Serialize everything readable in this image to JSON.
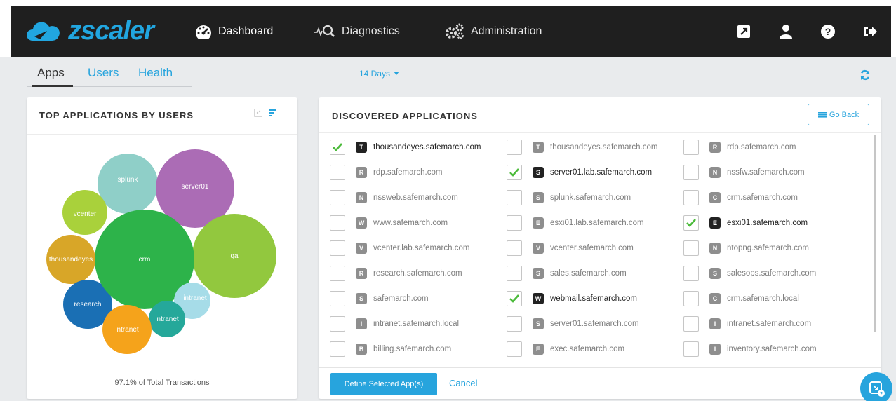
{
  "brand": {
    "name": "zscaler",
    "accent": "#27a4dd"
  },
  "nav": {
    "dashboard": "Dashboard",
    "diagnostics": "Diagnostics",
    "administration": "Administration"
  },
  "top_icons": [
    "external-link-icon",
    "user-icon",
    "help-icon",
    "logout-icon"
  ],
  "tabs": {
    "apps": "Apps",
    "users": "Users",
    "health": "Health"
  },
  "range": {
    "label": "14 Days"
  },
  "left_panel": {
    "title": "TOP APPLICATIONS BY USERS",
    "footnote": "97.1% of Total Transactions",
    "bubbles": [
      {
        "label": "splunk",
        "color": "#8fcfc8"
      },
      {
        "label": "server01",
        "color": "#ab6cb5"
      },
      {
        "label": "vcenter",
        "color": "#a9d13b"
      },
      {
        "label": "crm",
        "color": "#2db34a"
      },
      {
        "label": "qa",
        "color": "#92c83e"
      },
      {
        "label": "thousandeyes",
        "color": "#d8a628"
      },
      {
        "label": "research",
        "color": "#1a6fb4"
      },
      {
        "label": "intranet",
        "color": "#f5a31b"
      },
      {
        "label": "intranet",
        "color": "#25a89a"
      },
      {
        "label": "intranet",
        "color": "#a6dce8"
      }
    ]
  },
  "right_panel": {
    "title": "DISCOVERED APPLICATIONS",
    "go_back": "Go Back",
    "define_button": "Define Selected App(s)",
    "cancel": "Cancel",
    "columns": [
      [
        {
          "letter": "T",
          "name": "thousandeyes.safemarch.com",
          "checked": true
        },
        {
          "letter": "R",
          "name": "rdp.safemarch.com",
          "checked": false
        },
        {
          "letter": "N",
          "name": "nssweb.safemarch.com",
          "checked": false
        },
        {
          "letter": "W",
          "name": "www.safemarch.com",
          "checked": false
        },
        {
          "letter": "V",
          "name": "vcenter.lab.safemarch.com",
          "checked": false
        },
        {
          "letter": "R",
          "name": "research.safemarch.com",
          "checked": false
        },
        {
          "letter": "S",
          "name": "safemarch.com",
          "checked": false
        },
        {
          "letter": "I",
          "name": "intranet.safemarch.local",
          "checked": false
        },
        {
          "letter": "B",
          "name": "billing.safemarch.com",
          "checked": false
        }
      ],
      [
        {
          "letter": "T",
          "name": "thousandeyes.safemarch.com",
          "checked": false
        },
        {
          "letter": "S",
          "name": "server01.lab.safemarch.com",
          "checked": true
        },
        {
          "letter": "S",
          "name": "splunk.safemarch.com",
          "checked": false
        },
        {
          "letter": "E",
          "name": "esxi01.lab.safemarch.com",
          "checked": false
        },
        {
          "letter": "V",
          "name": "vcenter.safemarch.com",
          "checked": false
        },
        {
          "letter": "S",
          "name": "sales.safemarch.com",
          "checked": false
        },
        {
          "letter": "W",
          "name": "webmail.safemarch.com",
          "checked": true
        },
        {
          "letter": "S",
          "name": "server01.safemarch.com",
          "checked": false
        },
        {
          "letter": "E",
          "name": "exec.safemarch.com",
          "checked": false
        }
      ],
      [
        {
          "letter": "R",
          "name": "rdp.safemarch.com",
          "checked": false
        },
        {
          "letter": "N",
          "name": "nssfw.safemarch.com",
          "checked": false
        },
        {
          "letter": "C",
          "name": "crm.safemarch.com",
          "checked": false
        },
        {
          "letter": "E",
          "name": "esxi01.safemarch.com",
          "checked": true
        },
        {
          "letter": "N",
          "name": "ntopng.safemarch.com",
          "checked": false
        },
        {
          "letter": "S",
          "name": "salesops.safemarch.com",
          "checked": false
        },
        {
          "letter": "C",
          "name": "crm.safemarch.local",
          "checked": false
        },
        {
          "letter": "I",
          "name": "intranet.safemarch.com",
          "checked": false
        },
        {
          "letter": "I",
          "name": "inventory.safemarch.com",
          "checked": false
        }
      ]
    ]
  }
}
